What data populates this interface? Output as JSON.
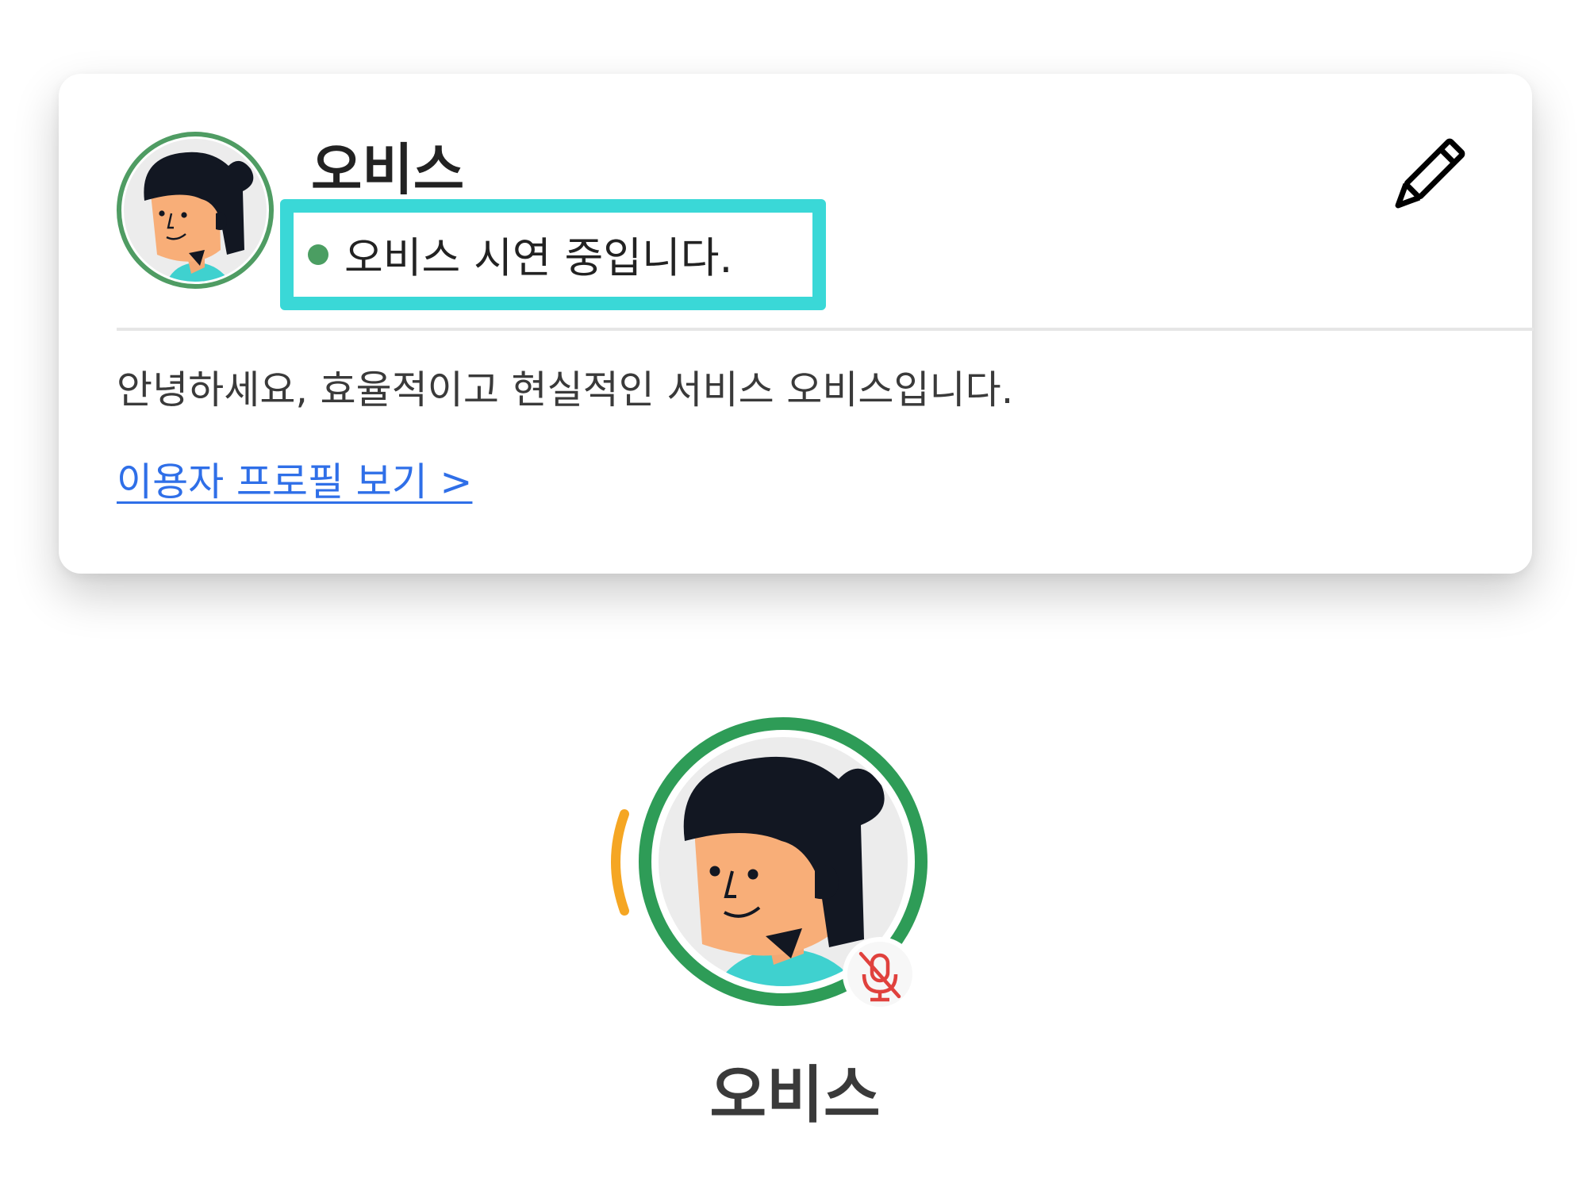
{
  "profile_card": {
    "name": "오비스",
    "status": {
      "text": "오비스 시연 중입니다.",
      "indicator_color": "#4b9e62"
    },
    "edit_icon": "pencil-icon",
    "introduction": "안녕하세요, 효율적이고 현실적인 서비스 오비스입니다.",
    "view_profile_link": "이용자 프로필 보기 >",
    "highlight_color": "#3ad8d7"
  },
  "speaker": {
    "name": "오비스",
    "ring_color": "#2e9c57",
    "speaking_indicator_color": "#f5a623",
    "mic_status_icon": "microphone-muted-icon",
    "mic_status_color": "#e0413d"
  }
}
